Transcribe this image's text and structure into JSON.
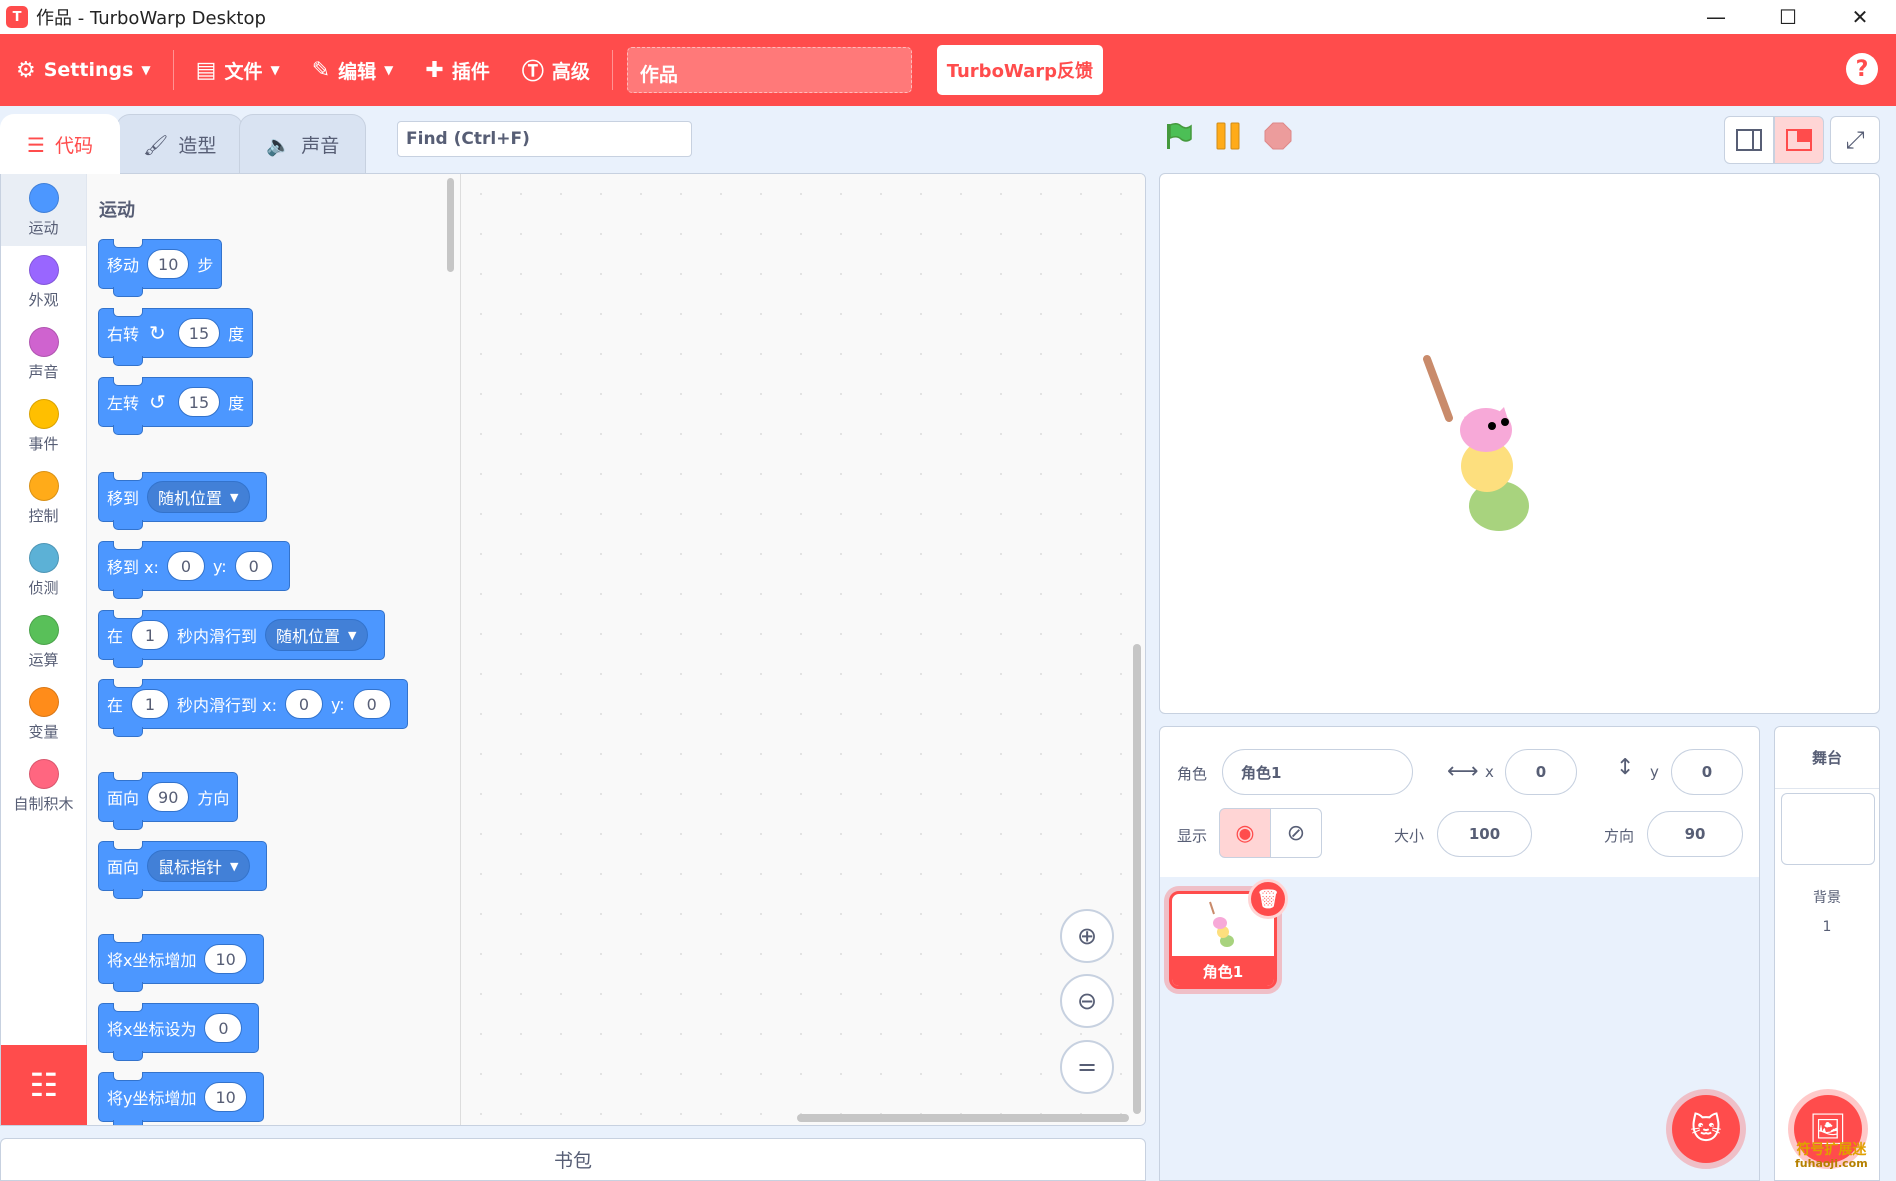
{
  "window": {
    "title": "作品 - TurboWarp Desktop",
    "minimize": "—",
    "maximize": "☐",
    "close": "✕"
  },
  "menu": {
    "settings": "Settings",
    "file": "文件",
    "edit": "编辑",
    "extensions": "插件",
    "advanced": "高级",
    "project_title": "作品",
    "feedback": "TurboWarp反馈",
    "help": "?"
  },
  "tabs": {
    "code": "代码",
    "costumes": "造型",
    "sounds": "声音"
  },
  "find": {
    "placeholder": "Find (Ctrl+F)"
  },
  "categories": [
    {
      "label": "运动",
      "color": "#4c97ff"
    },
    {
      "label": "外观",
      "color": "#9966ff"
    },
    {
      "label": "声音",
      "color": "#cf63cf"
    },
    {
      "label": "事件",
      "color": "#ffbf00"
    },
    {
      "label": "控制",
      "color": "#ffab19"
    },
    {
      "label": "侦测",
      "color": "#5cb1d6"
    },
    {
      "label": "运算",
      "color": "#59c059"
    },
    {
      "label": "变量",
      "color": "#ff8c1a"
    },
    {
      "label": "自制积木",
      "color": "#ff6680"
    }
  ],
  "palette": {
    "title": "运动",
    "blocks": {
      "move": {
        "a": "移动",
        "v": "10",
        "b": "步"
      },
      "turn_right": {
        "a": "右转",
        "v": "15",
        "b": "度"
      },
      "turn_left": {
        "a": "左转",
        "v": "15",
        "b": "度"
      },
      "goto": {
        "a": "移到",
        "d": "随机位置"
      },
      "goto_xy": {
        "a": "移到 x:",
        "x": "0",
        "y_label": "y:",
        "y": "0"
      },
      "glide": {
        "a": "在",
        "v": "1",
        "b": "秒内滑行到",
        "d": "随机位置"
      },
      "glide_xy": {
        "a": "在",
        "v": "1",
        "b": "秒内滑行到 x:",
        "x": "0",
        "y_label": "y:",
        "y": "0"
      },
      "point_dir": {
        "a": "面向",
        "v": "90",
        "b": "方向"
      },
      "point_towards": {
        "a": "面向",
        "d": "鼠标指针"
      },
      "change_x": {
        "a": "将x坐标增加",
        "v": "10"
      },
      "set_x": {
        "a": "将x坐标设为",
        "v": "0"
      },
      "change_y": {
        "a": "将y坐标增加",
        "v": "10"
      }
    }
  },
  "backpack": "书包",
  "sprite_info": {
    "sprite_label": "角色",
    "sprite_name": "角色1",
    "x_label": "x",
    "x": "0",
    "y_label": "y",
    "y": "0",
    "show_label": "显示",
    "size_label": "大小",
    "size": "100",
    "direction_label": "方向",
    "direction": "90"
  },
  "sprites": [
    {
      "name": "角色1"
    }
  ],
  "stage_pane": {
    "header": "舞台",
    "backdrops_label": "背景",
    "backdrops_count": "1"
  },
  "watermark": {
    "line1": "符号扩展迷",
    "line2": "fuhaoji.com"
  },
  "colors": {
    "accent": "#ff4c4c",
    "motion": "#4c97ff",
    "flag": "#4cbf56",
    "pause": "#ffab19",
    "stop": "#ec9c9c"
  }
}
